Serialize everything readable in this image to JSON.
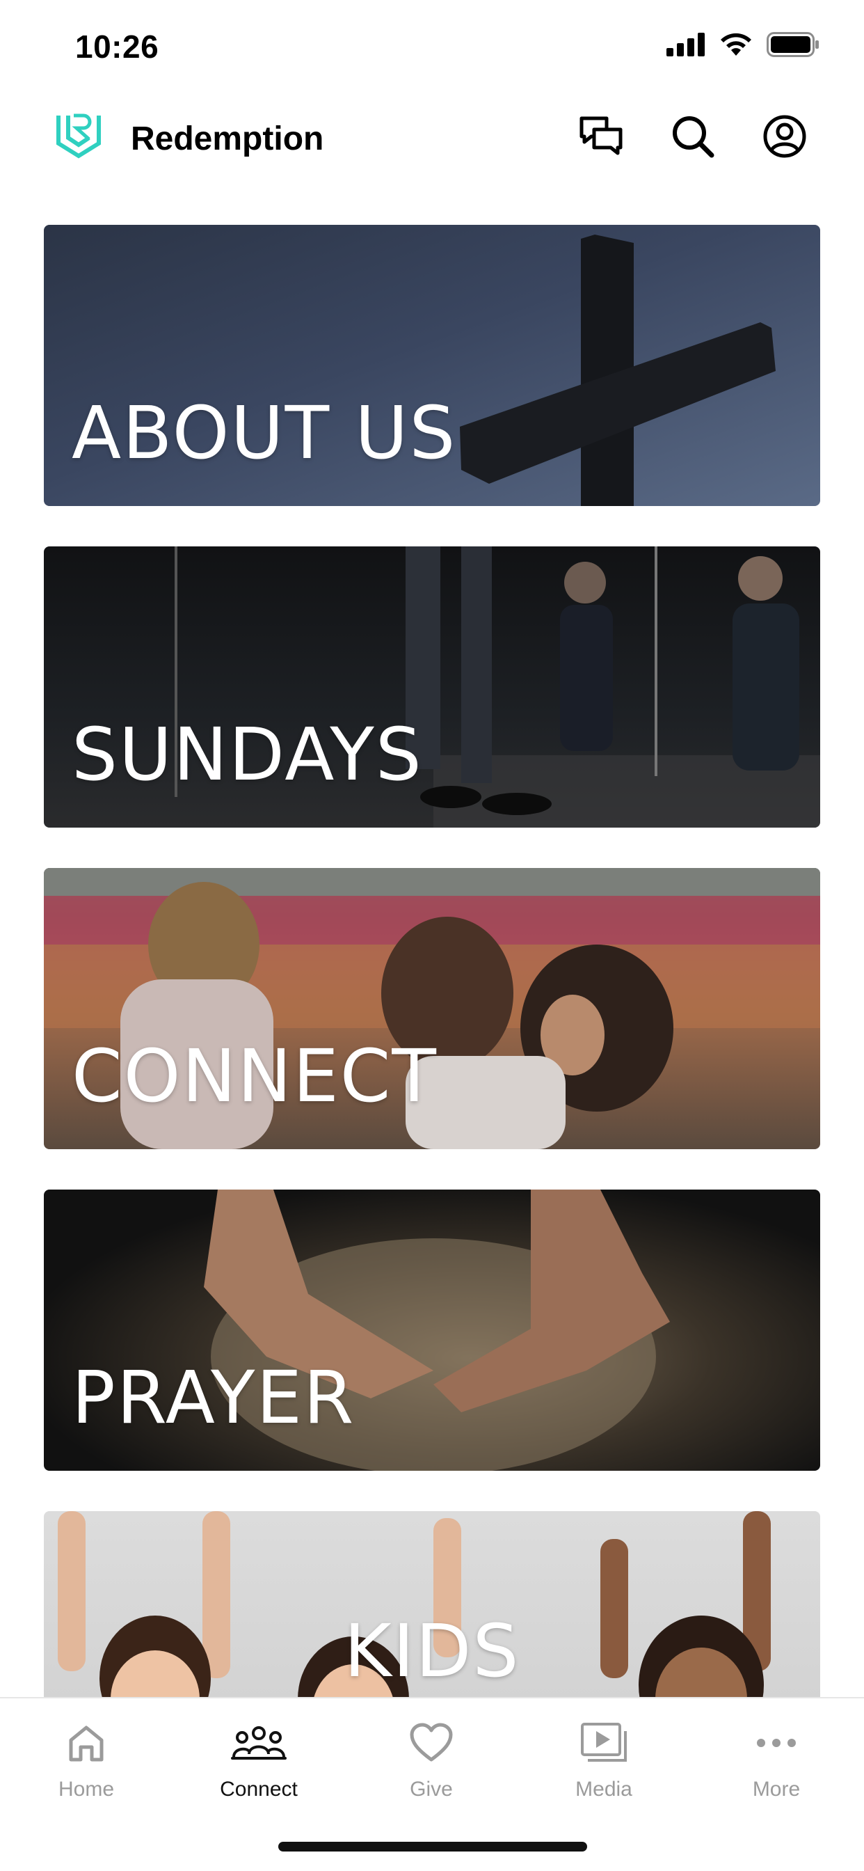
{
  "status_bar": {
    "time": "10:26",
    "icons": [
      "signal-icon",
      "wifi-icon",
      "battery-icon"
    ]
  },
  "header": {
    "app_name": "Redemption",
    "logo": "redemption-logo",
    "actions": [
      "chat-icon",
      "search-icon",
      "profile-icon"
    ],
    "accent_color": "#2fd0c0"
  },
  "cards": [
    {
      "label": "ABOUT US"
    },
    {
      "label": "SUNDAYS"
    },
    {
      "label": "CONNECT"
    },
    {
      "label": "PRAYER"
    },
    {
      "label": "KIDS"
    }
  ],
  "tab_bar": {
    "tabs": [
      {
        "label": "Home",
        "icon": "home-icon",
        "active": false
      },
      {
        "label": "Connect",
        "icon": "people-icon",
        "active": true
      },
      {
        "label": "Give",
        "icon": "heart-icon",
        "active": false
      },
      {
        "label": "Media",
        "icon": "media-icon",
        "active": false
      },
      {
        "label": "More",
        "icon": "more-icon",
        "active": false
      }
    ]
  }
}
